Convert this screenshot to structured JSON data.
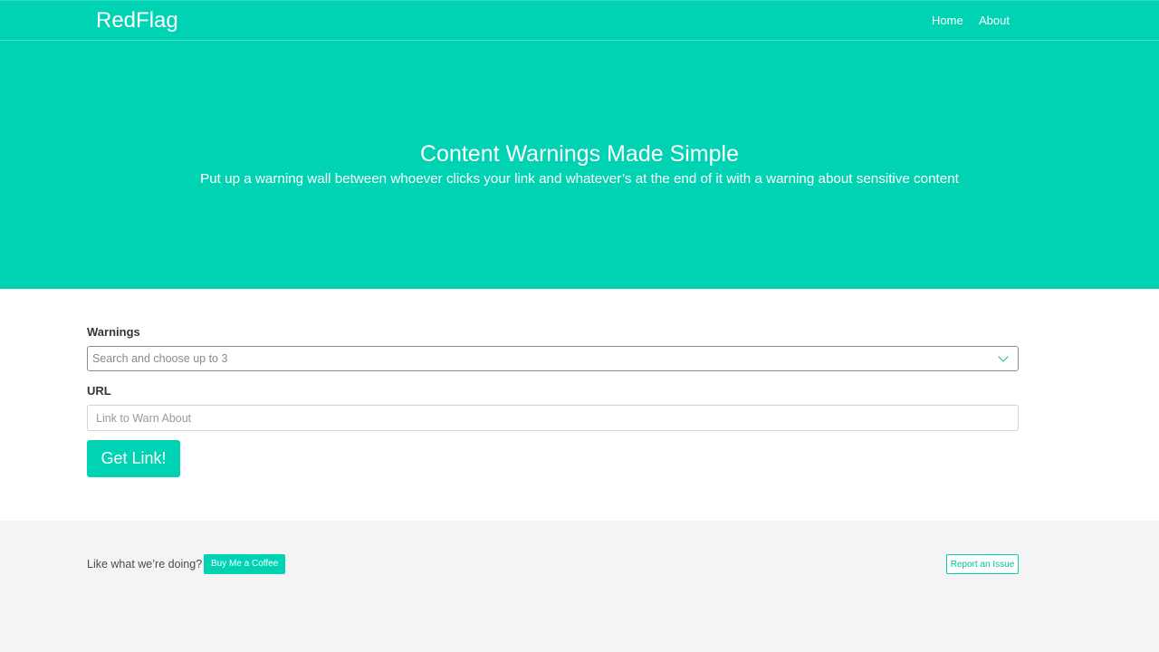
{
  "navbar": {
    "brand": "RedFlag",
    "links": [
      {
        "label": "Home"
      },
      {
        "label": "About"
      }
    ]
  },
  "hero": {
    "title": "Content Warnings Made Simple",
    "subtitle": "Put up a warning wall between whoever clicks your link and whatever’s at the end of it with a warning about sensitive content"
  },
  "form": {
    "warnings_label": "Warnings",
    "warnings_placeholder": "Search and choose up to 3",
    "url_label": "URL",
    "url_placeholder": "Link to Warn About",
    "submit_label": "Get Link!"
  },
  "footer": {
    "prompt": "Like what we’re doing?",
    "coffee_label": "Buy Me a Coffee",
    "issue_label": "Report an Issue"
  },
  "colors": {
    "accent": "#00d3b4",
    "footer_bg": "#f4f4f4"
  }
}
